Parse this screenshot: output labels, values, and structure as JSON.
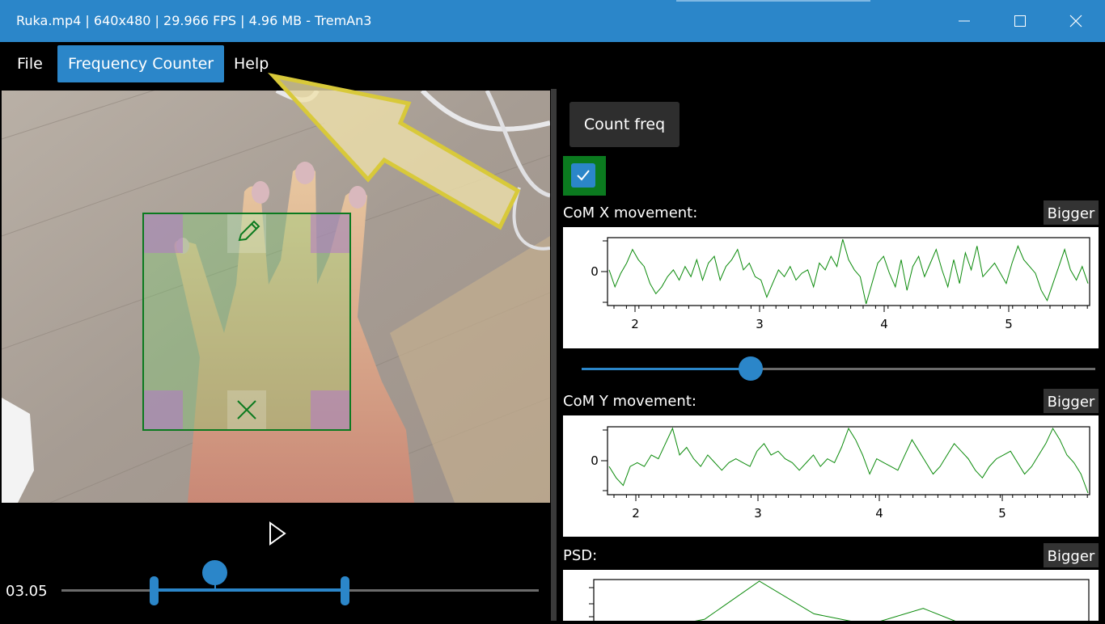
{
  "window": {
    "title": "Ruka.mp4 | 640x480 | 29.966 FPS | 4.96 MB - TremAn3",
    "controls": [
      "minimize-icon",
      "maximize-icon",
      "close-icon"
    ]
  },
  "menu": {
    "file": "File",
    "frequency_counter": "Frequency Counter",
    "help": "Help"
  },
  "player": {
    "time": "03.05"
  },
  "right_panel": {
    "count_button": "Count freq",
    "checkbox_checked": true,
    "com_x": {
      "label": "CoM X movement:",
      "bigger": "Bigger"
    },
    "com_y": {
      "label": "CoM Y movement:",
      "bigger": "Bigger"
    },
    "psd": {
      "label": "PSD:",
      "bigger": "Bigger"
    }
  },
  "colors": {
    "accent": "#2b86c9",
    "series": "#0a8a0a",
    "roi": "#0b7a1f",
    "arrow": "#d8c93a"
  },
  "chart_data": [
    {
      "type": "line",
      "series": [
        {
          "values": [
            0.2,
            -0.3,
            0.1,
            0.4,
            0.8,
            0.5,
            0.3,
            -0.2,
            -0.5,
            -0.3,
            0.0,
            0.2,
            -0.1,
            0.3,
            0.0,
            0.5,
            -0.1,
            0.4,
            0.6,
            -0.1,
            0.3,
            0.5,
            0.8,
            0.2,
            0.4,
            0.0,
            -0.1,
            -0.6,
            -0.2,
            0.2,
            0.0,
            0.3,
            -0.1,
            0.1,
            0.2,
            -0.3,
            0.4,
            0.2,
            0.6,
            0.3,
            1.1,
            0.5,
            0.2,
            0.0,
            -0.8,
            -0.2,
            0.4,
            0.6,
            0.1,
            -0.3,
            0.5,
            -0.4,
            0.3,
            0.6,
            0.0,
            0.4,
            0.8,
            0.2,
            -0.3,
            0.5,
            -0.2,
            0.7,
            0.2,
            0.9,
            0.0,
            0.2,
            0.4,
            0.1,
            -0.2,
            0.4,
            0.9,
            0.5,
            0.3,
            0.1,
            -0.4,
            -0.7,
            -0.2,
            0.3,
            0.8,
            0.2,
            -0.1,
            0.3,
            -0.2
          ]
        }
      ],
      "xticks": [
        "2",
        "3",
        "4",
        "5"
      ],
      "yticks": [
        "0"
      ]
    },
    {
      "type": "line",
      "series": [
        {
          "values": [
            -0.1,
            -0.4,
            -0.6,
            -0.1,
            0.0,
            -0.1,
            0.2,
            0.1,
            0.5,
            0.9,
            0.2,
            0.4,
            0.1,
            -0.1,
            0.2,
            0.0,
            -0.2,
            0.0,
            0.1,
            0.0,
            -0.1,
            0.3,
            0.5,
            0.2,
            0.3,
            0.1,
            0.0,
            -0.2,
            0.0,
            0.2,
            -0.1,
            0.1,
            0.0,
            0.4,
            0.9,
            0.6,
            0.2,
            -0.3,
            0.1,
            0.0,
            -0.1,
            -0.2,
            0.2,
            0.6,
            0.3,
            0.0,
            -0.3,
            -0.1,
            0.2,
            0.5,
            0.3,
            0.1,
            -0.2,
            -0.4,
            -0.1,
            0.1,
            0.2,
            0.3,
            0.0,
            -0.3,
            -0.1,
            0.2,
            0.5,
            0.9,
            0.6,
            0.2,
            0.0,
            -0.3,
            -0.8
          ]
        }
      ],
      "xticks": [
        "2",
        "3",
        "4",
        "5"
      ],
      "yticks": [
        "0"
      ]
    },
    {
      "type": "line",
      "series": [
        {
          "values": [
            0.05,
            0.1,
            0.3,
            1.0,
            0.4,
            0.2,
            0.5,
            0.1,
            0.05,
            0.02
          ]
        }
      ],
      "xticks": [],
      "yticks": []
    }
  ]
}
